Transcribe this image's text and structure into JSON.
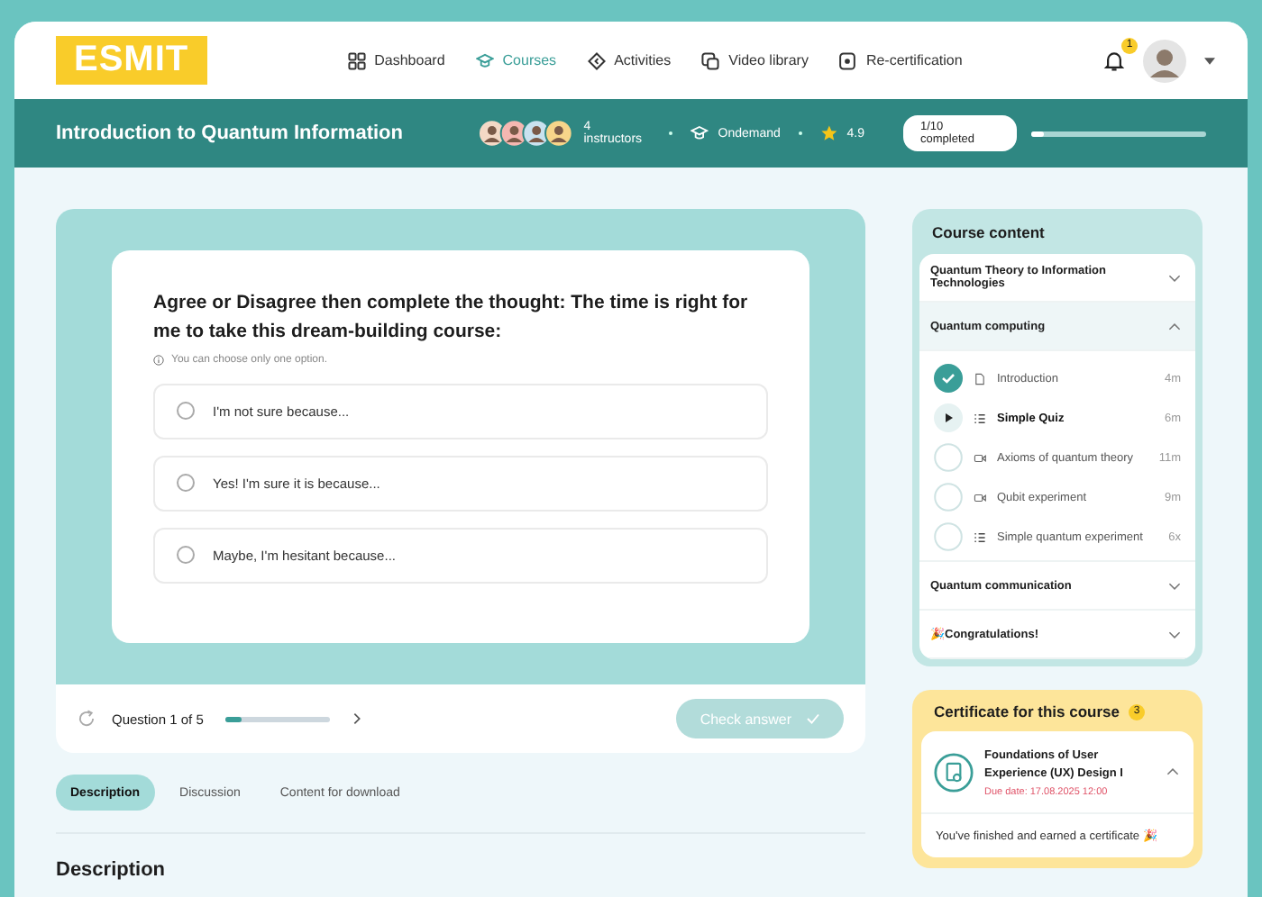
{
  "logo": "ESMIT",
  "nav": [
    {
      "label": "Dashboard",
      "kind": "grid",
      "selected": false
    },
    {
      "label": "Courses",
      "kind": "cap",
      "selected": true
    },
    {
      "label": "Activities",
      "kind": "diamond",
      "selected": false
    },
    {
      "label": "Video library",
      "kind": "video",
      "selected": false
    },
    {
      "label": "Re-certification",
      "kind": "cert",
      "selected": false
    }
  ],
  "notifications": {
    "badge": "1"
  },
  "course_bar": {
    "title": "Introduction to Quantum Information",
    "instructors": "4 instructors",
    "mode": "Ondemand",
    "rating": "4.9",
    "completed": "1/10 completed",
    "level": 0.08
  },
  "quiz": {
    "question": "Agree or Disagree then complete the thought: The time is right for me to take this dream-building course:",
    "hint": "You can choose only one option.",
    "options": [
      {
        "label": "I'm not sure because...",
        "selected": false
      },
      {
        "label": "Yes! I'm sure it is because...",
        "selected": false
      },
      {
        "label": "Maybe, I'm hesitant because...",
        "selected": false
      }
    ],
    "counter": "Question 1 of 5",
    "level": 0.15,
    "check_button": {
      "label": "Check answer",
      "disabled": true
    }
  },
  "tabs": [
    {
      "label": "Description",
      "selected": true
    },
    {
      "label": "Discussion",
      "selected": false
    },
    {
      "label": "Content for download",
      "selected": false
    }
  ],
  "description_heading": "Description",
  "course_content": {
    "title": "Course content",
    "sections": [
      {
        "title": "Quantum Theory to Information Technologies",
        "expanded": false
      },
      {
        "title": "Quantum computing",
        "expanded": true,
        "lessons": [
          {
            "title": "Introduction",
            "kind": "doc",
            "completed": true,
            "current": false,
            "duration": "4m"
          },
          {
            "title": "Simple Quiz",
            "kind": "list",
            "completed": false,
            "current": true,
            "duration": "6m"
          },
          {
            "title": "Axioms of quantum theory",
            "kind": "video",
            "completed": false,
            "current": false,
            "duration": "11m"
          },
          {
            "title": "Qubit experiment",
            "kind": "video",
            "completed": false,
            "current": false,
            "duration": "9m"
          },
          {
            "title": "Simple quantum experiment",
            "kind": "list",
            "completed": false,
            "current": false,
            "duration": "6x"
          }
        ]
      },
      {
        "title": "Quantum communication",
        "expanded": false
      },
      {
        "title": "Congratulations!",
        "emoji": "🎉",
        "expanded": false
      }
    ]
  },
  "certificate": {
    "title": "Certificate for this course",
    "badge": "3",
    "name": "Foundations of User Experience (UX) Design I",
    "due": "Due date: 17.08.2025 12:00",
    "expanded": true,
    "message": "You've finished and earned a certificate",
    "emoji": "🎉"
  }
}
